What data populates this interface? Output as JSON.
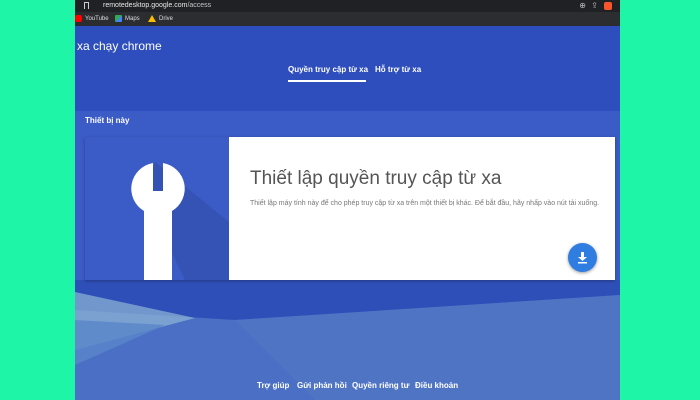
{
  "browser": {
    "url_host": "remotedesktop.google.com",
    "url_path": "/access",
    "bookmarks": [
      "YouTube",
      "Maps",
      "Drive"
    ]
  },
  "app": {
    "title": "xa chạy chrome"
  },
  "tabs": [
    {
      "label": "Quyền truy cập từ xa",
      "active": true
    },
    {
      "label": "Hỗ trợ từ xa",
      "active": false
    }
  ],
  "section": {
    "title": "Thiết bị này"
  },
  "card": {
    "title": "Thiết lập quyền truy cập từ xa",
    "description": "Thiết lập máy tính này để cho phép truy cập từ xa trên một thiết bị khác. Để bắt đầu, hãy nhấp vào nút tải xuống.",
    "icon": "wrench-icon",
    "action_icon": "download-icon"
  },
  "footer": {
    "links": [
      "Trợ giúp",
      "Gửi phản hồi",
      "Quyền riêng tư",
      "Điều khoản"
    ]
  },
  "colors": {
    "page_bg": "#1ef5a6",
    "header_bg": "#2d4ebc",
    "content_bg": "#3b5bc6",
    "card_bg": "#ffffff",
    "fab": "#2f7de1"
  }
}
